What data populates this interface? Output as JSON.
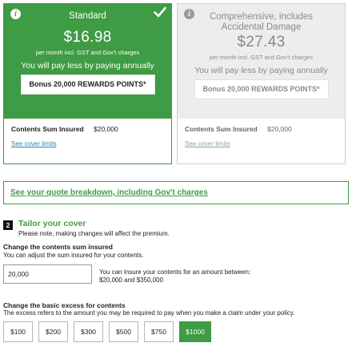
{
  "plans": [
    {
      "name": "Standard",
      "price": "$16.98",
      "price_note": "per month incl. GST and Gov't charges",
      "annual_note": "You will pay less by paying annually",
      "bonus": "Bonus 20,000 REWARDS POINTS*",
      "sum_label": "Contents Sum Insured",
      "sum_value": "$20,000",
      "cover_link": "See cover limits",
      "selected": true
    },
    {
      "name": "Comprehensive, includes Accidental Damage",
      "price": "$27.43",
      "price_note": "per month incl. GST and Gov't charges",
      "annual_note": "You will pay less by paying annually",
      "bonus": "Bonus 20,000 REWARDS POINTS*",
      "sum_label": "Contents Sum Insured",
      "sum_value": "$20,000",
      "cover_link": "See cover limits",
      "selected": false
    }
  ],
  "breakdown_link": "See your quote breakdown, including Gov't charges",
  "step": {
    "number": "2",
    "title": "Tailor your cover",
    "subtitle": "Please note, making changes will affect the premium."
  },
  "sum_insured": {
    "title": "Change the contents sum insured",
    "subtitle": "You can adjust the sum insured for your contents.",
    "value": "20,000",
    "range_note_line1": "You can insure your contents for an amount between:",
    "range_note_line2": "$20,000 and $350,000"
  },
  "excess": {
    "title": "Change the basic excess for contents",
    "subtitle": "The excess refers to the amount you may be required to pay when you make a claim under your policy.",
    "options": [
      "$100",
      "$200",
      "$300",
      "$500",
      "$750",
      "$1000"
    ],
    "selected": "$1000"
  },
  "colors": {
    "accent": "#3f9b44",
    "link": "#2e7fae"
  }
}
